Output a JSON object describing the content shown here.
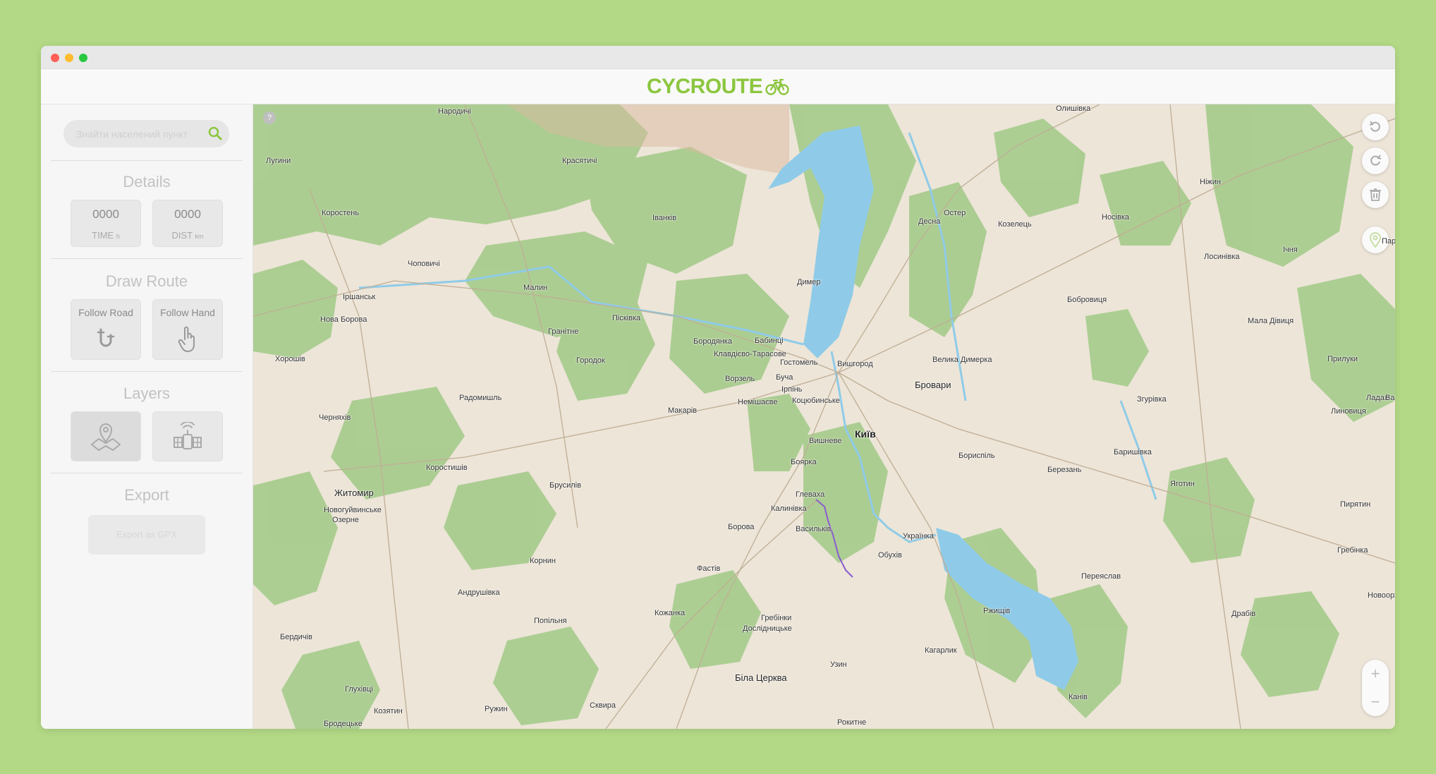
{
  "app": {
    "name": "CYCROUTE",
    "brand_color": "#8cc63f",
    "logo_icon": "bicycle-icon"
  },
  "sidebar": {
    "search": {
      "placeholder": "Знайти населений пункт",
      "value": "",
      "icon": "search-icon"
    },
    "details": {
      "title": "Details",
      "time": {
        "value": "0000",
        "label": "TIME",
        "unit": "h"
      },
      "distance": {
        "value": "0000",
        "label": "DIST",
        "unit": "km"
      }
    },
    "draw_route": {
      "title": "Draw Route",
      "follow_road": {
        "label": "Follow Road",
        "icon": "magnet-icon"
      },
      "follow_hand": {
        "label": "Follow Hand",
        "icon": "hand-pointer-icon"
      }
    },
    "layers": {
      "title": "Layers",
      "items": [
        {
          "name": "map-layer",
          "icon": "map-pin-icon",
          "active": true
        },
        {
          "name": "satellite-layer",
          "icon": "satellite-icon",
          "active": false
        }
      ]
    },
    "export": {
      "title": "Export",
      "button_label": "Export as GPX"
    }
  },
  "map": {
    "help": "?",
    "controls": [
      "undo-icon",
      "redo-icon",
      "trash-icon",
      "location-pin-icon"
    ],
    "zoom_in": "+",
    "zoom_out": "−",
    "places": [
      {
        "key": "olyshivka",
        "label": "Олишівка"
      },
      {
        "key": "narodychi",
        "label": "Народичі"
      },
      {
        "key": "luhyny",
        "label": "Лугини"
      },
      {
        "key": "krasiatychi",
        "label": "Красятичі"
      },
      {
        "key": "korosten",
        "label": "Коростень"
      },
      {
        "key": "ivankiv",
        "label": "Іванків"
      },
      {
        "key": "desna",
        "label": "Десна"
      },
      {
        "key": "oster",
        "label": "Остер"
      },
      {
        "key": "kozelets",
        "label": "Козелець"
      },
      {
        "key": "nosivka",
        "label": "Носівка"
      },
      {
        "key": "nizhyn",
        "label": "Ніжин"
      },
      {
        "key": "ichnia",
        "label": "Ічня"
      },
      {
        "key": "losynivka",
        "label": "Лосинівка"
      },
      {
        "key": "par",
        "label": "Пар"
      },
      {
        "key": "chopovychi",
        "label": "Чоповичі"
      },
      {
        "key": "malyn",
        "label": "Малин"
      },
      {
        "key": "dymer",
        "label": "Димер"
      },
      {
        "key": "irshansk",
        "label": "Іршанськ"
      },
      {
        "key": "nova_borova",
        "label": "Нова Борова"
      },
      {
        "key": "piskivka",
        "label": "Пісківка"
      },
      {
        "key": "hranitne",
        "label": "Гранітне"
      },
      {
        "key": "babyntsi",
        "label": "Бабинці"
      },
      {
        "key": "borodianka",
        "label": "Бородянка"
      },
      {
        "key": "bobrovytsia",
        "label": "Бобровиця"
      },
      {
        "key": "mala_divytsia",
        "label": "Мала Дівиця"
      },
      {
        "key": "khoroshiv",
        "label": "Хорошів"
      },
      {
        "key": "horodok",
        "label": "Городок"
      },
      {
        "key": "klavdievo",
        "label": "Клавдієво-Тарасове"
      },
      {
        "key": "hostomel",
        "label": "Гостомель"
      },
      {
        "key": "vyshhorod",
        "label": "Вишгород"
      },
      {
        "key": "velyka_dymerka",
        "label": "Велика Димерка"
      },
      {
        "key": "pryluky",
        "label": "Прилуки"
      },
      {
        "key": "vorzel",
        "label": "Ворзель"
      },
      {
        "key": "bucha",
        "label": "Буча"
      },
      {
        "key": "irpin",
        "label": "Ірпінь"
      },
      {
        "key": "radomyshl",
        "label": "Радомишль"
      },
      {
        "key": "nemishaieve",
        "label": "Немішаєве"
      },
      {
        "key": "kotsiubynske",
        "label": "Коцюбинське"
      },
      {
        "key": "brovary",
        "label": "Бровари"
      },
      {
        "key": "zhurivka",
        "label": "Згурівка"
      },
      {
        "key": "ladan",
        "label": "Ладан"
      },
      {
        "key": "varva",
        "label": "Варв"
      },
      {
        "key": "makariv",
        "label": "Макарів"
      },
      {
        "key": "kyiv",
        "label": "Київ"
      },
      {
        "key": "liubech",
        "label": "Линовиця"
      },
      {
        "key": "cherniakhiv",
        "label": "Черняхів"
      },
      {
        "key": "vyshneve",
        "label": "Вишневе"
      },
      {
        "key": "baryshivka",
        "label": "Баришівка"
      },
      {
        "key": "boryspil",
        "label": "Бориспіль"
      },
      {
        "key": "korostyshiv",
        "label": "Коростишів"
      },
      {
        "key": "boiarka",
        "label": "Боярка"
      },
      {
        "key": "berezan",
        "label": "Березань"
      },
      {
        "key": "zhytomyr",
        "label": "Житомир"
      },
      {
        "key": "brusyliv",
        "label": "Брусилів"
      },
      {
        "key": "hlevakha",
        "label": "Глеваха"
      },
      {
        "key": "yahotyn",
        "label": "Яготин"
      },
      {
        "key": "novohuivynske",
        "label": "Новогуйвинське"
      },
      {
        "key": "kalynivka",
        "label": "Калинівка"
      },
      {
        "key": "pyriatyn",
        "label": "Пирятин"
      },
      {
        "key": "ozerne",
        "label": "Озерне"
      },
      {
        "key": "borova",
        "label": "Борова"
      },
      {
        "key": "vasylkiv",
        "label": "Васильків"
      },
      {
        "key": "ukrainka",
        "label": "Українка"
      },
      {
        "key": "hrebinka",
        "label": "Гребінка"
      },
      {
        "key": "kornyn",
        "label": "Корнин"
      },
      {
        "key": "obukhiv",
        "label": "Обухів"
      },
      {
        "key": "fastiv",
        "label": "Фастів"
      },
      {
        "key": "pereiaslav",
        "label": "Переяслав"
      },
      {
        "key": "novorozh",
        "label": "Новоорж"
      },
      {
        "key": "andrushivka",
        "label": "Андрушівка"
      },
      {
        "key": "kozhanka",
        "label": "Кожанка"
      },
      {
        "key": "rzhyshchiv",
        "label": "Ржищів"
      },
      {
        "key": "drabiv",
        "label": "Драбів"
      },
      {
        "key": "popilnia",
        "label": "Попільня"
      },
      {
        "key": "hrebinky",
        "label": "Гребінки"
      },
      {
        "key": "doslidnytske",
        "label": "Дослідницьке"
      },
      {
        "key": "berdychiv",
        "label": "Бердичів"
      },
      {
        "key": "kaharlyk",
        "label": "Кагарлик"
      },
      {
        "key": "uzyn",
        "label": "Узин"
      },
      {
        "key": "bila_tserkva",
        "label": "Біла Церква"
      },
      {
        "key": "hlukhivtsi",
        "label": "Глухівці"
      },
      {
        "key": "kaniv",
        "label": "Канів"
      },
      {
        "key": "koziatyn",
        "label": "Козятин"
      },
      {
        "key": "ruzhyn",
        "label": "Ружин"
      },
      {
        "key": "skvyra",
        "label": "Сквира"
      },
      {
        "key": "rokytne",
        "label": "Рокитне"
      },
      {
        "key": "brodetske",
        "label": "Бродецьке"
      }
    ]
  }
}
